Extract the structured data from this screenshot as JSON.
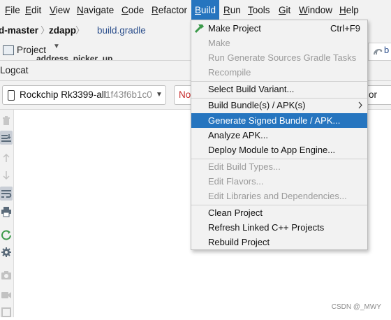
{
  "menubar": {
    "items": [
      {
        "label": "File",
        "mnemonic": "F",
        "rest": "ile"
      },
      {
        "label": "Edit",
        "mnemonic": "E",
        "rest": "dit"
      },
      {
        "label": "View",
        "mnemonic": "V",
        "rest": "iew"
      },
      {
        "label": "Navigate",
        "mnemonic": "N",
        "rest": "avigate"
      },
      {
        "label": "Code",
        "mnemonic": "C",
        "rest": "ode"
      },
      {
        "label": "Refactor",
        "mnemonic": "R",
        "rest": "efactor"
      },
      {
        "label": "Build",
        "mnemonic": "B",
        "rest": "uild"
      },
      {
        "label": "Run",
        "mnemonic": "R",
        "rest": "un"
      },
      {
        "label": "Tools",
        "mnemonic": "T",
        "rest": "ools"
      },
      {
        "label": "Git",
        "mnemonic": "G",
        "rest": "it"
      },
      {
        "label": "Window",
        "mnemonic": "W",
        "rest": "indow"
      },
      {
        "label": "Help",
        "mnemonic": "H",
        "rest": "elp"
      }
    ]
  },
  "breadcrumb": {
    "root": "d-master",
    "module": "zdapp",
    "file": "build.gradle"
  },
  "project_panel": {
    "label": "Project",
    "behind_text": "address_picker_up",
    "tab_partial": "b"
  },
  "logcat": {
    "title": "Logcat",
    "device_name": "Rockchip Rk3399-all",
    "device_serial": "1f43f6b1c0",
    "filter_partial": "No",
    "right_partial": "or"
  },
  "build_menu": {
    "items": [
      {
        "label": "Make Project",
        "shortcut": "Ctrl+F9",
        "enabled": true
      },
      {
        "label": "Make",
        "enabled": false
      },
      {
        "label": "Run Generate Sources Gradle Tasks",
        "enabled": false
      },
      {
        "label": "Recompile",
        "enabled": false
      },
      {
        "label": "Select Build Variant...",
        "enabled": true
      },
      {
        "label": "Build Bundle(s) / APK(s)",
        "enabled": true,
        "submenu": true
      },
      {
        "label": "Generate Signed Bundle / APK...",
        "enabled": true,
        "highlighted": true
      },
      {
        "label": "Analyze APK...",
        "enabled": true
      },
      {
        "label": "Deploy Module to App Engine...",
        "enabled": true
      },
      {
        "label": "Edit Build Types...",
        "enabled": false
      },
      {
        "label": "Edit Flavors...",
        "enabled": false
      },
      {
        "label": "Edit Libraries and Dependencies...",
        "enabled": false
      },
      {
        "label": "Clean Project",
        "enabled": true
      },
      {
        "label": "Refresh Linked C++ Projects",
        "enabled": true
      },
      {
        "label": "Rebuild Project",
        "enabled": true
      }
    ]
  },
  "watermark": "CSDN @_MWY",
  "colors": {
    "highlight": "#2675bf",
    "menu_bg": "#f2f2f2",
    "disabled_text": "#9b9b9b",
    "error_red": "#c62828"
  }
}
